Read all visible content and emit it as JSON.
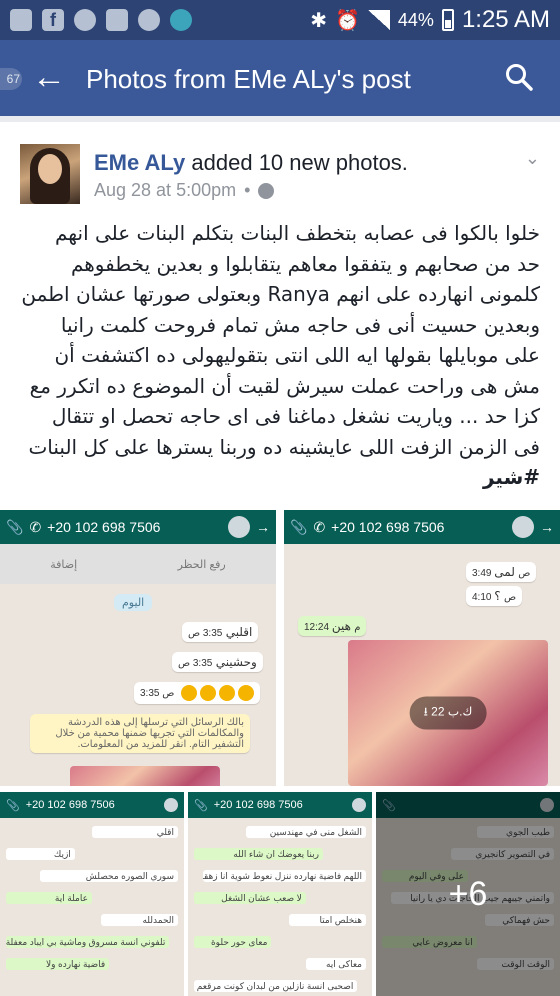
{
  "status_bar": {
    "battery": "44%",
    "time": "1:25 AM",
    "icons": [
      "mail-icon",
      "facebook-icon",
      "messenger-icon",
      "sms-icon",
      "whatsapp-icon",
      "circle-icon",
      "bluetooth-icon",
      "alarm-icon",
      "signal-icon",
      "battery-icon"
    ]
  },
  "app_bar": {
    "title": "Photos from EMe ALy's post",
    "side_badge": "67"
  },
  "post": {
    "author": "EMe ALy",
    "action": "added 10 new photos.",
    "date": "Aug 28 at 5:00pm",
    "text_lines": [
      "خلوا بالكوا فى عصابه بتخطف البنات بتكلم البنات على انهم",
      "حد من صحابهم و يتفقوا معاهم يتقابلوا و بعدين يخطفوهم",
      "كلمونى انهارده على انهم Ranya وبعتولى صورتها عشان اطمن",
      "وبعدين حسيت أنى فى حاجه مش تمام فروحت كلمت رانيا",
      "على موبايلها بقولها ايه اللى انتى بتقوليهولى ده اكتشفت أن",
      "مش هى وراحت عملت سيرش لقيت أن الموضوع ده اتكرر مع",
      "كزا حد ... وياريت نشغل دماغنا فى اى حاجه تحصل او تتقال",
      "فى الزمن الزفت اللى عايشينه ده وربنا يسترها على كل البنات"
    ],
    "hashtag": "#شير"
  },
  "photos": {
    "phone_number": "+20 102 698 7506",
    "shot1": {
      "tabs": [
        "إضافة",
        "رفع الحظر"
      ],
      "date_pill": "اليوم",
      "msg1": "اقلبي",
      "msg1_time": "3:35 ص",
      "msg2": "وحشيني",
      "msg2_time": "3:35 ص",
      "msg3_time": "3:35 ص",
      "notice": "بالك الرسائل التي ترسلها إلى هذه الدردشة والمكالمات التي تجريها ضمنها محمية من خلال التشفير التام. انقر للمزيد من المعلومات."
    },
    "shot2": {
      "msg1": "لمى",
      "msg1_time": "3:49 ص",
      "msg2": "؟",
      "msg2_time": "4:10 ص",
      "msg3": "هين",
      "msg3_time": "12:24 م",
      "download_size": "22 ك.ب"
    },
    "shot3": {
      "lines": [
        "اقلي",
        "ازيك",
        "سوري الصوره محصلش",
        "عاملة اية",
        "الحمدلله",
        "تلفوني انسة مسروق وماشية بي ايباد معفلة",
        "فاضية نهارده ولا"
      ]
    },
    "shot4": {
      "lines": [
        "الشغل منى في مهندسين",
        "ربنا يعوضك ان شاء الله",
        "اللهم فاضية نهارده ننزل نعوط شوية انا زهقانة ومخنوقة",
        "لا صعب عشان الشغل",
        "هنخلص امتا",
        "معاى حور حلوة",
        "معاكى ايه",
        "اصحبى انسة نازلين من لبدان كونت مرقعم من"
      ]
    },
    "shot5": {
      "more": "+6",
      "lines": [
        "طيب الجوي",
        "في التصوير كانجيري",
        "على وفي اليوم",
        "واتمني جيبهم جيب الحاجات دي يا رانيا",
        "حش فهماكي",
        "انا معروض عايي",
        "الوقت الوقت"
      ]
    }
  }
}
